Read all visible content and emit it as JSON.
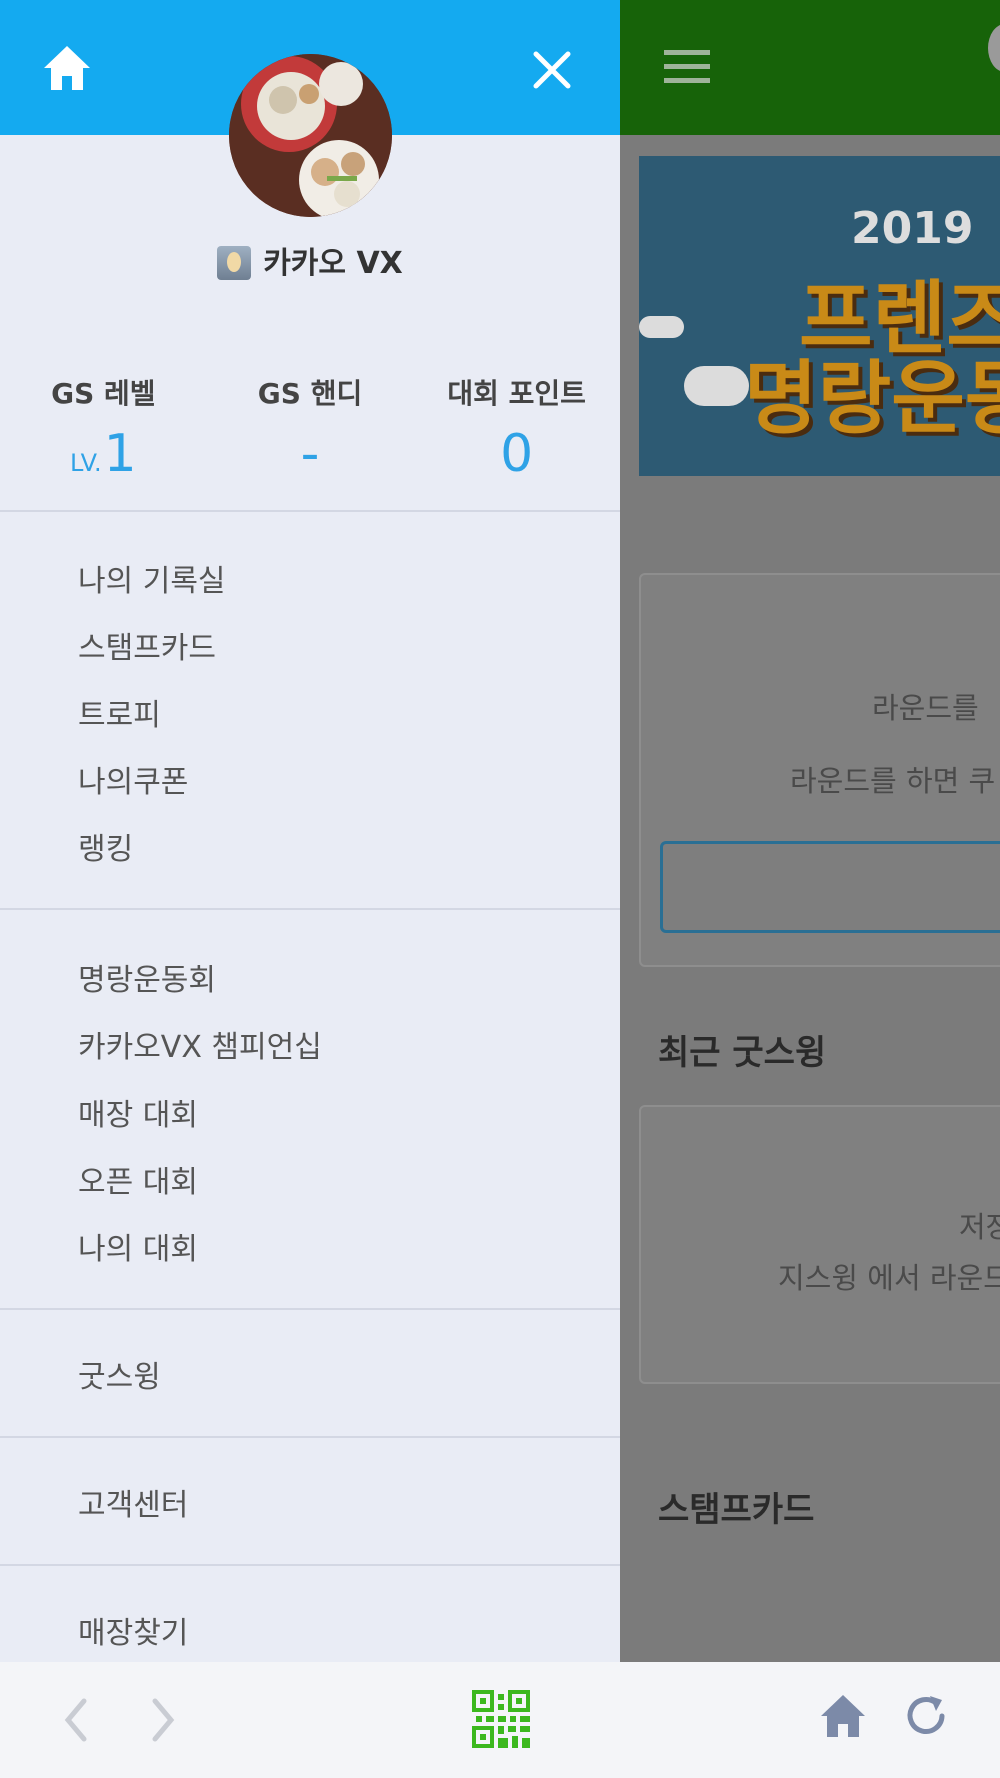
{
  "drawer": {
    "profile": {
      "name": "카카오 VX"
    },
    "stats": [
      {
        "label": "GS 레벨",
        "prefix": "LV.",
        "value": "1"
      },
      {
        "label": "GS 핸디",
        "value": "-"
      },
      {
        "label": "대회 포인트",
        "value": "0"
      }
    ],
    "menu_groups": [
      [
        "나의 기록실",
        "스탬프카드",
        "트로피",
        "나의쿠폰",
        "랭킹"
      ],
      [
        "명랑운동회",
        "카카오VX 챔피언십",
        "매장 대회",
        "오픈 대회",
        "나의 대회"
      ],
      [
        "굿스윙"
      ],
      [
        "고객센터"
      ],
      [
        "매장찾기"
      ]
    ]
  },
  "main": {
    "banner": {
      "year": "2019",
      "line1": "프렌즈",
      "line2": "명랑운동"
    },
    "round_card": {
      "text1": "라운드를",
      "text2": "라운드를 하면 쿠"
    },
    "recent_goodswing": {
      "title": "최근 굿스윙",
      "text1": "저장",
      "text2": "지스윙 에서 라운드"
    },
    "stampcard": {
      "title": "스탬프카드"
    }
  },
  "colors": {
    "header_blue": "#14aaf0",
    "topbar_green": "#176309",
    "accent_blue": "#2fa2e6",
    "qr_green": "#3cb81e"
  }
}
